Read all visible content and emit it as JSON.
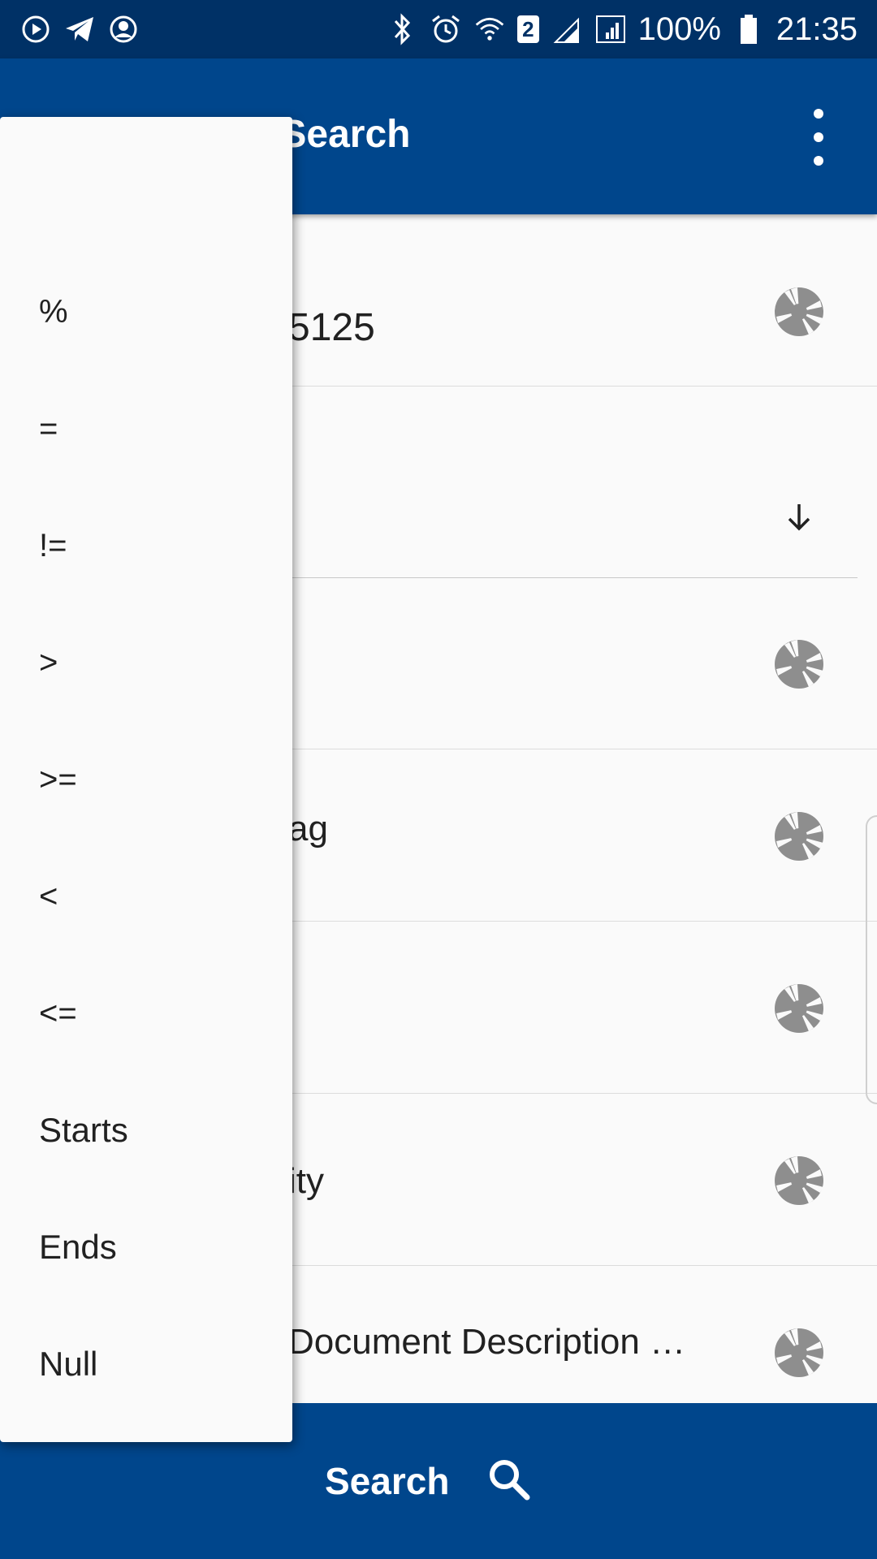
{
  "status_bar": {
    "battery": "100%",
    "time": "21:35",
    "sim_badge": "2",
    "icons": [
      "play-circle-icon",
      "telegram-icon",
      "account-circle-icon",
      "bluetooth-icon",
      "alarm-icon",
      "wifi-icon",
      "signal-icon",
      "signal-icon-2",
      "battery-icon"
    ]
  },
  "app_bar": {
    "title": "V Search",
    "overflow_icon": "more-vert-icon"
  },
  "rows": [
    {
      "text": "5125",
      "icon": "aperture-icon"
    },
    {
      "text": "",
      "icon": "arrow-down-icon"
    },
    {
      "text": "",
      "icon": "aperture-icon"
    },
    {
      "text": "ag",
      "icon": "aperture-icon"
    },
    {
      "text": "",
      "icon": "aperture-icon"
    },
    {
      "text": "ity",
      "icon": "aperture-icon"
    },
    {
      "text": "Document Description …",
      "icon": "aperture-icon"
    }
  ],
  "bottom_bar": {
    "search_label": "Search",
    "search_icon": "search-icon"
  },
  "popup_menu": {
    "items": [
      "%",
      "=",
      "!=",
      ">",
      ">=",
      "<",
      "<=",
      "Starts",
      "Ends",
      "Null"
    ]
  },
  "colors": {
    "status_bar": "#003166",
    "primary": "#00468c",
    "background": "#fafafa",
    "icon_gray": "#8e8e8e"
  }
}
